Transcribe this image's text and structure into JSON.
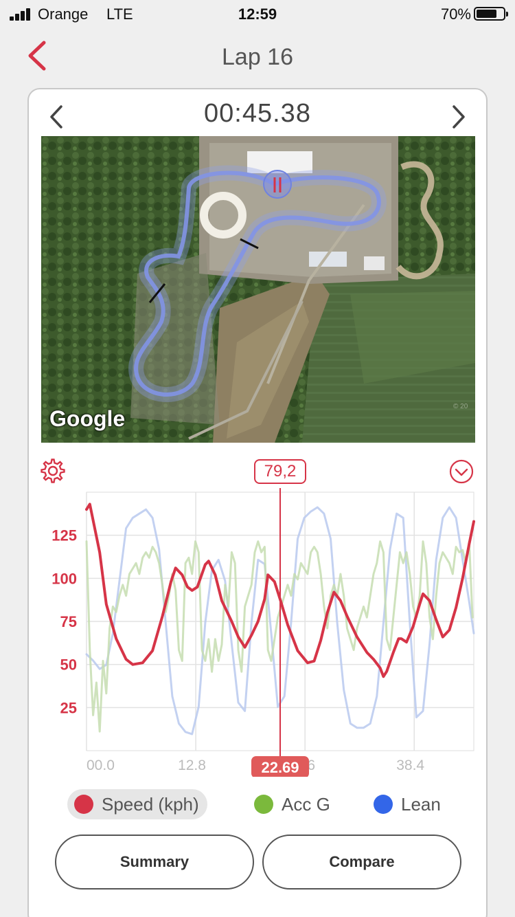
{
  "status": {
    "carrier": "Orange",
    "network": "LTE",
    "time": "12:59",
    "battery": "70%"
  },
  "header": {
    "title": "Lap 16"
  },
  "lap": {
    "time": "00:45.38"
  },
  "map": {
    "attribution": "Google"
  },
  "chart_header": {
    "value": "79,2"
  },
  "chart_data": {
    "type": "line",
    "x_range": [
      0,
      45.38
    ],
    "x_ticks": [
      "00.0",
      "12.8",
      "25.6",
      "38.4"
    ],
    "y_ticks": [
      "125",
      "100",
      "75",
      "50",
      "25"
    ],
    "ylim": [
      0,
      150
    ],
    "cursor": {
      "x": 22.69,
      "label": "22.69"
    },
    "series": [
      {
        "name": "Speed (kph)",
        "color": "#d63447",
        "axis": "speed",
        "points": [
          [
            0,
            140
          ],
          [
            0.5,
            143
          ],
          [
            2,
            115
          ],
          [
            3,
            85
          ],
          [
            4.5,
            65
          ],
          [
            6,
            53
          ],
          [
            7,
            50
          ],
          [
            8.5,
            51
          ],
          [
            10,
            58
          ],
          [
            11.5,
            78
          ],
          [
            12.8,
            98
          ],
          [
            13.5,
            106
          ],
          [
            14.5,
            102
          ],
          [
            15.3,
            95
          ],
          [
            16,
            93
          ],
          [
            16.8,
            95
          ],
          [
            18,
            108
          ],
          [
            18.5,
            110
          ],
          [
            19.5,
            102
          ],
          [
            20.5,
            87
          ],
          [
            22,
            75
          ],
          [
            23,
            66
          ],
          [
            24,
            60
          ],
          [
            25,
            67
          ],
          [
            26,
            75
          ],
          [
            27,
            88
          ],
          [
            27.5,
            102
          ],
          [
            28.5,
            98
          ],
          [
            29.5,
            86
          ],
          [
            30.5,
            73
          ],
          [
            32,
            58
          ],
          [
            33.5,
            51
          ],
          [
            34.5,
            52
          ],
          [
            35.5,
            64
          ],
          [
            36.5,
            80
          ],
          [
            37.5,
            92
          ],
          [
            38.5,
            87
          ],
          [
            39.5,
            78
          ],
          [
            41,
            66
          ],
          [
            42.5,
            57
          ],
          [
            43.5,
            53
          ],
          [
            44.5,
            48
          ],
          [
            45,
            43
          ],
          [
            45.5,
            46
          ],
          [
            46.5,
            57
          ],
          [
            47.3,
            65
          ],
          [
            47.7,
            65
          ],
          [
            48.5,
            63
          ],
          [
            49.5,
            72
          ],
          [
            50.5,
            85
          ],
          [
            51,
            91
          ],
          [
            52,
            87
          ],
          [
            53,
            76
          ],
          [
            54,
            66
          ],
          [
            55,
            70
          ],
          [
            56,
            83
          ],
          [
            57,
            100
          ],
          [
            58,
            120
          ],
          [
            58.7,
            133
          ]
        ]
      },
      {
        "name": "Acc G",
        "color": "#c5ddb0",
        "axis": "g",
        "points": [
          [
            0,
            0.8
          ],
          [
            0.5,
            -0.2
          ],
          [
            1,
            -0.8
          ],
          [
            1.5,
            -0.5
          ],
          [
            2,
            -0.95
          ],
          [
            2.5,
            -0.3
          ],
          [
            3,
            -0.6
          ],
          [
            3.5,
            0.0
          ],
          [
            4,
            0.2
          ],
          [
            4.5,
            0.15
          ],
          [
            5,
            0.3
          ],
          [
            5.5,
            0.4
          ],
          [
            6,
            0.3
          ],
          [
            6.5,
            0.5
          ],
          [
            7,
            0.55
          ],
          [
            7.5,
            0.6
          ],
          [
            8,
            0.5
          ],
          [
            8.5,
            0.65
          ],
          [
            9,
            0.7
          ],
          [
            9.5,
            0.65
          ],
          [
            10,
            0.75
          ],
          [
            10.5,
            0.7
          ],
          [
            11,
            0.6
          ],
          [
            11.5,
            0.4
          ],
          [
            12,
            0.15
          ],
          [
            12.5,
            0.3
          ],
          [
            13,
            0.5
          ],
          [
            13.5,
            0.35
          ],
          [
            14,
            -0.2
          ],
          [
            14.5,
            -0.3
          ],
          [
            15,
            0.6
          ],
          [
            15.5,
            0.65
          ],
          [
            16,
            0.5
          ],
          [
            16.5,
            0.8
          ],
          [
            17,
            0.7
          ],
          [
            17.5,
            -0.2
          ],
          [
            18,
            -0.3
          ],
          [
            18.5,
            -0.1
          ],
          [
            19,
            -0.4
          ],
          [
            19.5,
            -0.1
          ],
          [
            20,
            -0.3
          ],
          [
            20.5,
            -0.15
          ],
          [
            21,
            0.4
          ],
          [
            21.5,
            0.2
          ],
          [
            22,
            0.7
          ],
          [
            22.5,
            0.6
          ],
          [
            23,
            -0.2
          ],
          [
            23.5,
            -0.4
          ],
          [
            24,
            0.2
          ],
          [
            24.5,
            0.3
          ],
          [
            25,
            0.4
          ],
          [
            25.5,
            0.7
          ],
          [
            26,
            0.8
          ],
          [
            26.5,
            0.7
          ],
          [
            27,
            0.75
          ],
          [
            27.5,
            -0.2
          ],
          [
            28,
            -0.3
          ],
          [
            28.5,
            -0.1
          ],
          [
            29,
            0.1
          ],
          [
            29.5,
            0.2
          ],
          [
            30,
            0.3
          ],
          [
            30.5,
            0.4
          ],
          [
            31,
            0.3
          ],
          [
            31.5,
            0.5
          ],
          [
            32,
            0.45
          ],
          [
            32.5,
            0.6
          ],
          [
            33,
            0.55
          ],
          [
            33.5,
            0.5
          ],
          [
            34,
            0.7
          ],
          [
            34.5,
            0.75
          ],
          [
            35,
            0.7
          ],
          [
            35.5,
            0.5
          ],
          [
            36,
            0.2
          ],
          [
            36.5,
            0.0
          ],
          [
            37,
            0.3
          ],
          [
            37.5,
            0.4
          ],
          [
            38,
            0.3
          ],
          [
            38.5,
            0.5
          ],
          [
            39,
            0.3
          ],
          [
            39.5,
            0.0
          ],
          [
            40,
            -0.1
          ],
          [
            40.5,
            -0.2
          ],
          [
            41,
            0.0
          ],
          [
            41.5,
            0.1
          ],
          [
            42,
            0.2
          ],
          [
            42.5,
            0.1
          ],
          [
            43,
            0.3
          ],
          [
            43.5,
            0.5
          ],
          [
            44,
            0.6
          ],
          [
            44.5,
            0.8
          ],
          [
            45,
            0.7
          ],
          [
            45.5,
            -0.1
          ],
          [
            46,
            -0.2
          ],
          [
            46.5,
            0.1
          ],
          [
            47,
            0.4
          ],
          [
            47.5,
            0.7
          ],
          [
            48,
            0.6
          ],
          [
            48.5,
            0.7
          ],
          [
            49,
            0.5
          ],
          [
            49.5,
            0.2
          ],
          [
            50,
            0.1
          ],
          [
            50.5,
            0.3
          ],
          [
            51,
            0.8
          ],
          [
            51.5,
            0.6
          ],
          [
            52,
            0.1
          ],
          [
            52.5,
            -0.1
          ],
          [
            53,
            0.3
          ],
          [
            53.5,
            0.6
          ],
          [
            54,
            0.7
          ],
          [
            54.5,
            0.65
          ],
          [
            55,
            0.6
          ],
          [
            55.5,
            0.5
          ],
          [
            56,
            0.75
          ],
          [
            56.5,
            0.7
          ],
          [
            57,
            0.72
          ],
          [
            57.5,
            0.6
          ],
          [
            58,
            0.8
          ],
          [
            58.5,
            0.1
          ]
        ]
      },
      {
        "name": "Lean",
        "color": "#b9c9ee",
        "axis": "lean",
        "points": [
          [
            0,
            -15
          ],
          [
            1,
            -18
          ],
          [
            2,
            -22
          ],
          [
            3,
            -20
          ],
          [
            4,
            -5
          ],
          [
            5,
            20
          ],
          [
            6,
            45
          ],
          [
            7,
            50
          ],
          [
            8,
            52
          ],
          [
            9,
            54
          ],
          [
            10,
            50
          ],
          [
            11,
            35
          ],
          [
            12,
            0
          ],
          [
            13,
            -35
          ],
          [
            14,
            -48
          ],
          [
            15,
            -52
          ],
          [
            16,
            -53
          ],
          [
            17,
            -40
          ],
          [
            18,
            0
          ],
          [
            19,
            25
          ],
          [
            20,
            30
          ],
          [
            21,
            20
          ],
          [
            22,
            -10
          ],
          [
            23,
            -38
          ],
          [
            24,
            -42
          ],
          [
            25,
            0
          ],
          [
            26,
            30
          ],
          [
            27,
            28
          ],
          [
            28,
            -5
          ],
          [
            29,
            -40
          ],
          [
            30,
            -35
          ],
          [
            31,
            0
          ],
          [
            32,
            40
          ],
          [
            33,
            50
          ],
          [
            34,
            53
          ],
          [
            35,
            55
          ],
          [
            36,
            52
          ],
          [
            37,
            40
          ],
          [
            38,
            0
          ],
          [
            39,
            -32
          ],
          [
            40,
            -48
          ],
          [
            41,
            -50
          ],
          [
            42,
            -50
          ],
          [
            43,
            -48
          ],
          [
            44,
            -35
          ],
          [
            45,
            0
          ],
          [
            46,
            35
          ],
          [
            47,
            52
          ],
          [
            48,
            50
          ],
          [
            49,
            0
          ],
          [
            50,
            -45
          ],
          [
            51,
            -42
          ],
          [
            52,
            -10
          ],
          [
            53,
            30
          ],
          [
            54,
            50
          ],
          [
            55,
            55
          ],
          [
            56,
            50
          ],
          [
            57,
            30
          ],
          [
            58,
            10
          ],
          [
            58.7,
            -5
          ]
        ]
      }
    ]
  },
  "legend": [
    {
      "label": "Speed (kph)",
      "color": "#d63447"
    },
    {
      "label": "Acc G",
      "color": "#7bb93c"
    },
    {
      "label": "Lean",
      "color": "#3366e8"
    }
  ],
  "buttons": {
    "summary": "Summary",
    "compare": "Compare"
  },
  "colors": {
    "accent": "#d63447"
  }
}
